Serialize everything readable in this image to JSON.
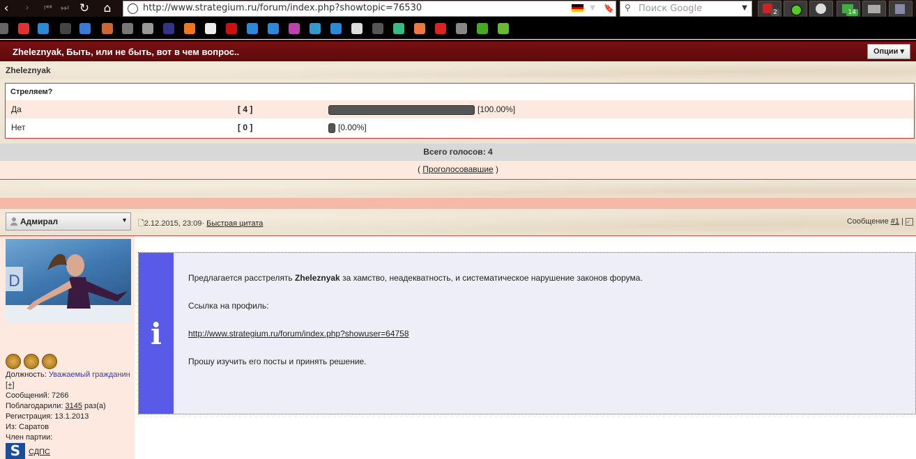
{
  "browser": {
    "url": "http://www.strategium.ru/forum/index.php?showtopic=76530",
    "search_placeholder": "Поиск Google",
    "ext_badges": [
      "2",
      "14"
    ]
  },
  "topic": {
    "title": "Zheleznyak, Быть, или не быть, вот в чем вопрос..",
    "options_label": "Опции ▾",
    "subtitle": "Zheleznyak"
  },
  "poll": {
    "question": "Стреляем?",
    "options": [
      {
        "label": "Да",
        "count": "[ 4 ]",
        "percent_label": "[100.00%]",
        "fraction": 1.0
      },
      {
        "label": "Нет",
        "count": "[ 0 ]",
        "percent_label": "[0.00%]",
        "fraction": 0.0
      }
    ],
    "total": "Всего голосов: 4",
    "voters_prefix": "(",
    "voters_link": "Проголосовавшие",
    "voters_suffix": ")"
  },
  "post": {
    "author": "Адмирал",
    "date": "2.12.2015, 23:09",
    "sep": "·",
    "quick_quote": "Быстрая цитата",
    "msg_label": "Сообщение",
    "msg_number": "#1",
    "msg_sep": "|"
  },
  "user": {
    "position_label": "Должность:",
    "position_value": "Уважаемый гражданин",
    "position_expand": "[+]",
    "posts": "Сообщений: 7266",
    "thanks_prefix": "Поблагодарили:",
    "thanks_value": "3145",
    "thanks_suffix": "раз(а)",
    "registered": "Регистрация: 13.1.2013",
    "from": "Из: Саратов",
    "party_label": "Член партии:",
    "party_name": "СДПС",
    "party_logo": "S"
  },
  "message": {
    "info_glyph": "i",
    "p1_before": "Предлагается расстрелять",
    "p1_bold": "Zheleznyak",
    "p1_after": "за хамство, неадекватность, и систематическое нарушение законов форума.",
    "p2": "Ссылка на профиль:",
    "p3_link": "http://www.strategium.ru/forum/index.php?showuser=64758",
    "p4": "Прошу изучить его посты и принять решение."
  }
}
